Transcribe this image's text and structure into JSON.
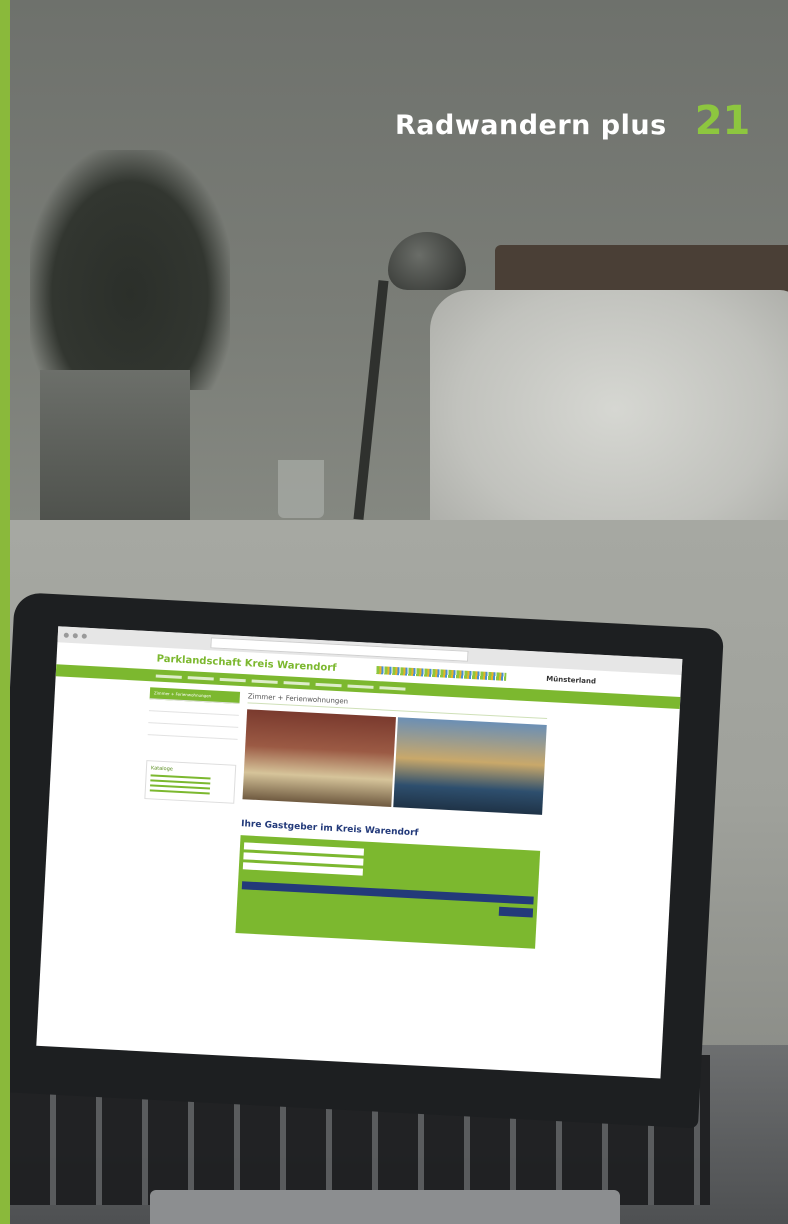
{
  "header": {
    "title": "Radwandern plus",
    "page_number": "21"
  },
  "screen": {
    "site_title": "Parklandschaft Kreis Warendorf",
    "region_label": "Münsterland",
    "page_heading": "Zimmer + Ferienwohnungen",
    "section_heading": "Ihre Gastgeber im Kreis Warendorf",
    "sidebar_active": "Zimmer + Ferienwohnungen",
    "catalog_title": "Kataloge"
  }
}
